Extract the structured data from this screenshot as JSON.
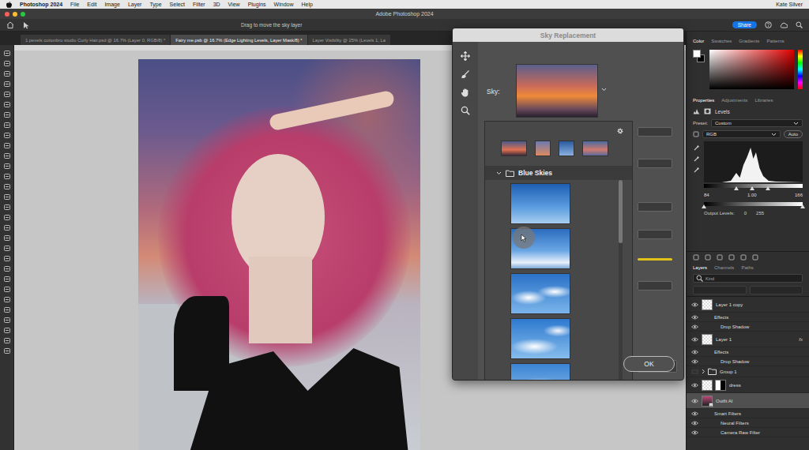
{
  "menubar": {
    "app": "Photoshop 2024",
    "items": [
      "File",
      "Edit",
      "Image",
      "Layer",
      "Type",
      "Select",
      "Filter",
      "3D",
      "View",
      "Plugins",
      "Window",
      "Help"
    ],
    "user": "Kate Silver"
  },
  "window": {
    "title": "Adobe Photoshop 2024"
  },
  "options_bar": {
    "hint": "Drag to move the sky layer",
    "share": "Share"
  },
  "doc_tabs": [
    {
      "label": "1 pexels cottonbro studio Curly Hair.psd @ 16.7% (Layer 0, RGB/8) *",
      "selected": false
    },
    {
      "label": "Fairy me.psb @ 16.7% (Edge Lighting Levels, Layer Mask/8) *",
      "selected": true
    },
    {
      "label": "Layer Visibility @ 25% (Levels 1, La",
      "selected": false
    }
  ],
  "dialog": {
    "title": "Sky Replacement",
    "sky_label": "Sky:",
    "folder": {
      "label": "Blue Skies",
      "expanded": true
    },
    "skies": [
      {
        "hovered": false
      },
      {
        "hovered": true
      },
      {
        "hovered": false
      },
      {
        "hovered": false
      },
      {
        "hovered": false
      }
    ],
    "ok": "OK"
  },
  "color_panel": {
    "tabs": [
      {
        "label": "Color",
        "selected": true
      },
      {
        "label": "Swatches",
        "selected": false
      },
      {
        "label": "Gradients",
        "selected": false
      },
      {
        "label": "Patterns",
        "selected": false
      }
    ]
  },
  "properties": {
    "tabs": [
      {
        "label": "Properties",
        "selected": true
      },
      {
        "label": "Adjustments",
        "selected": false
      },
      {
        "label": "Libraries",
        "selected": false
      }
    ],
    "adjustment": "Levels",
    "preset_label": "Preset:",
    "preset": "Custom",
    "channel": "RGB",
    "auto": "Auto",
    "input": [
      "84",
      "1.00",
      "166"
    ],
    "output_label": "Output Levels:",
    "output": [
      "0",
      "255"
    ]
  },
  "layers_panel": {
    "tabs": [
      {
        "label": "Layers",
        "selected": true
      },
      {
        "label": "Channels",
        "selected": false
      },
      {
        "label": "Paths",
        "selected": false
      }
    ],
    "filter": "Kind",
    "layers": [
      {
        "name": "Layer 1 copy",
        "kind": "layer",
        "visible": true,
        "selected": false
      },
      {
        "name": "Effects",
        "kind": "effects",
        "visible": true,
        "selected": false
      },
      {
        "name": "Drop Shadow",
        "kind": "effect",
        "visible": true,
        "selected": false
      },
      {
        "name": "Layer 1",
        "kind": "layer",
        "visible": true,
        "selected": false,
        "badge": "fx"
      },
      {
        "name": "Effects",
        "kind": "effects",
        "visible": true,
        "selected": false
      },
      {
        "name": "Drop Shadow",
        "kind": "effect",
        "visible": true,
        "selected": false
      },
      {
        "name": "Group 1",
        "kind": "group",
        "visible": false,
        "selected": false
      },
      {
        "name": "dress",
        "kind": "masked",
        "visible": true,
        "selected": false
      },
      {
        "name": "Outfit AI",
        "kind": "smart",
        "visible": true,
        "selected": true
      },
      {
        "name": "Smart Filters",
        "kind": "effects",
        "visible": true,
        "selected": false
      },
      {
        "name": "Neural Filters",
        "kind": "effect",
        "visible": true,
        "selected": false
      },
      {
        "name": "Camera Raw Filter",
        "kind": "effect",
        "visible": true,
        "selected": false
      }
    ]
  }
}
